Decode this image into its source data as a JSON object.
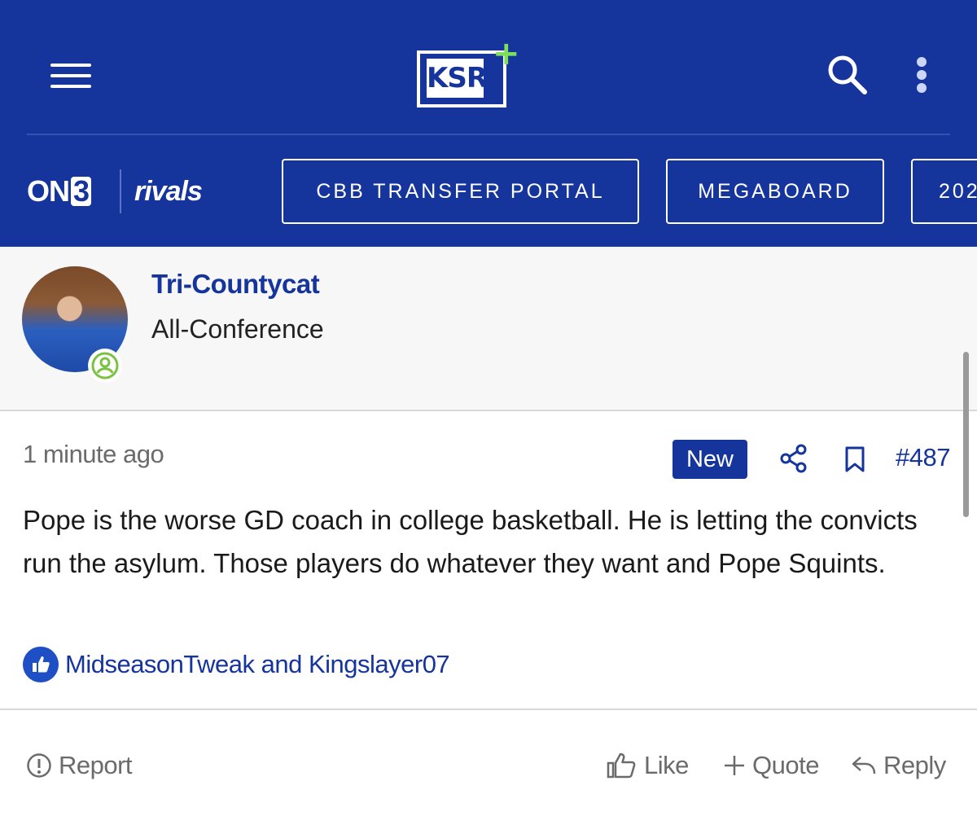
{
  "header": {
    "logo_text": "KSR",
    "logo_plus": "+",
    "brand_on": "ON",
    "brand_three": "3",
    "brand_rivals": "rivals",
    "bg_color": "#16359c",
    "nav_pills": [
      "CBB TRANSFER PORTAL",
      "MEGABOARD",
      "202"
    ]
  },
  "author": {
    "name": "Tri-Countycat",
    "title": "All-Conference",
    "online_indicator_color": "#7cc242"
  },
  "post": {
    "time": "1 minute ago",
    "badge": "New",
    "number": "#487",
    "body": "Pope is the worse GD coach in college basketball. He is letting the convicts run the asylum. Those players do whatever they want and Pope Squints.",
    "likes_text": "MidseasonTweak and Kingslayer07"
  },
  "actions": {
    "report": "Report",
    "like": "Like",
    "quote": "Quote",
    "reply": "Reply"
  },
  "icons": [
    "menu-icon",
    "search-icon",
    "more-vertical-icon",
    "user-online-icon",
    "share-icon",
    "bookmark-icon",
    "thumbs-up-icon",
    "report-icon",
    "like-icon",
    "quote-plus-icon",
    "reply-icon"
  ]
}
